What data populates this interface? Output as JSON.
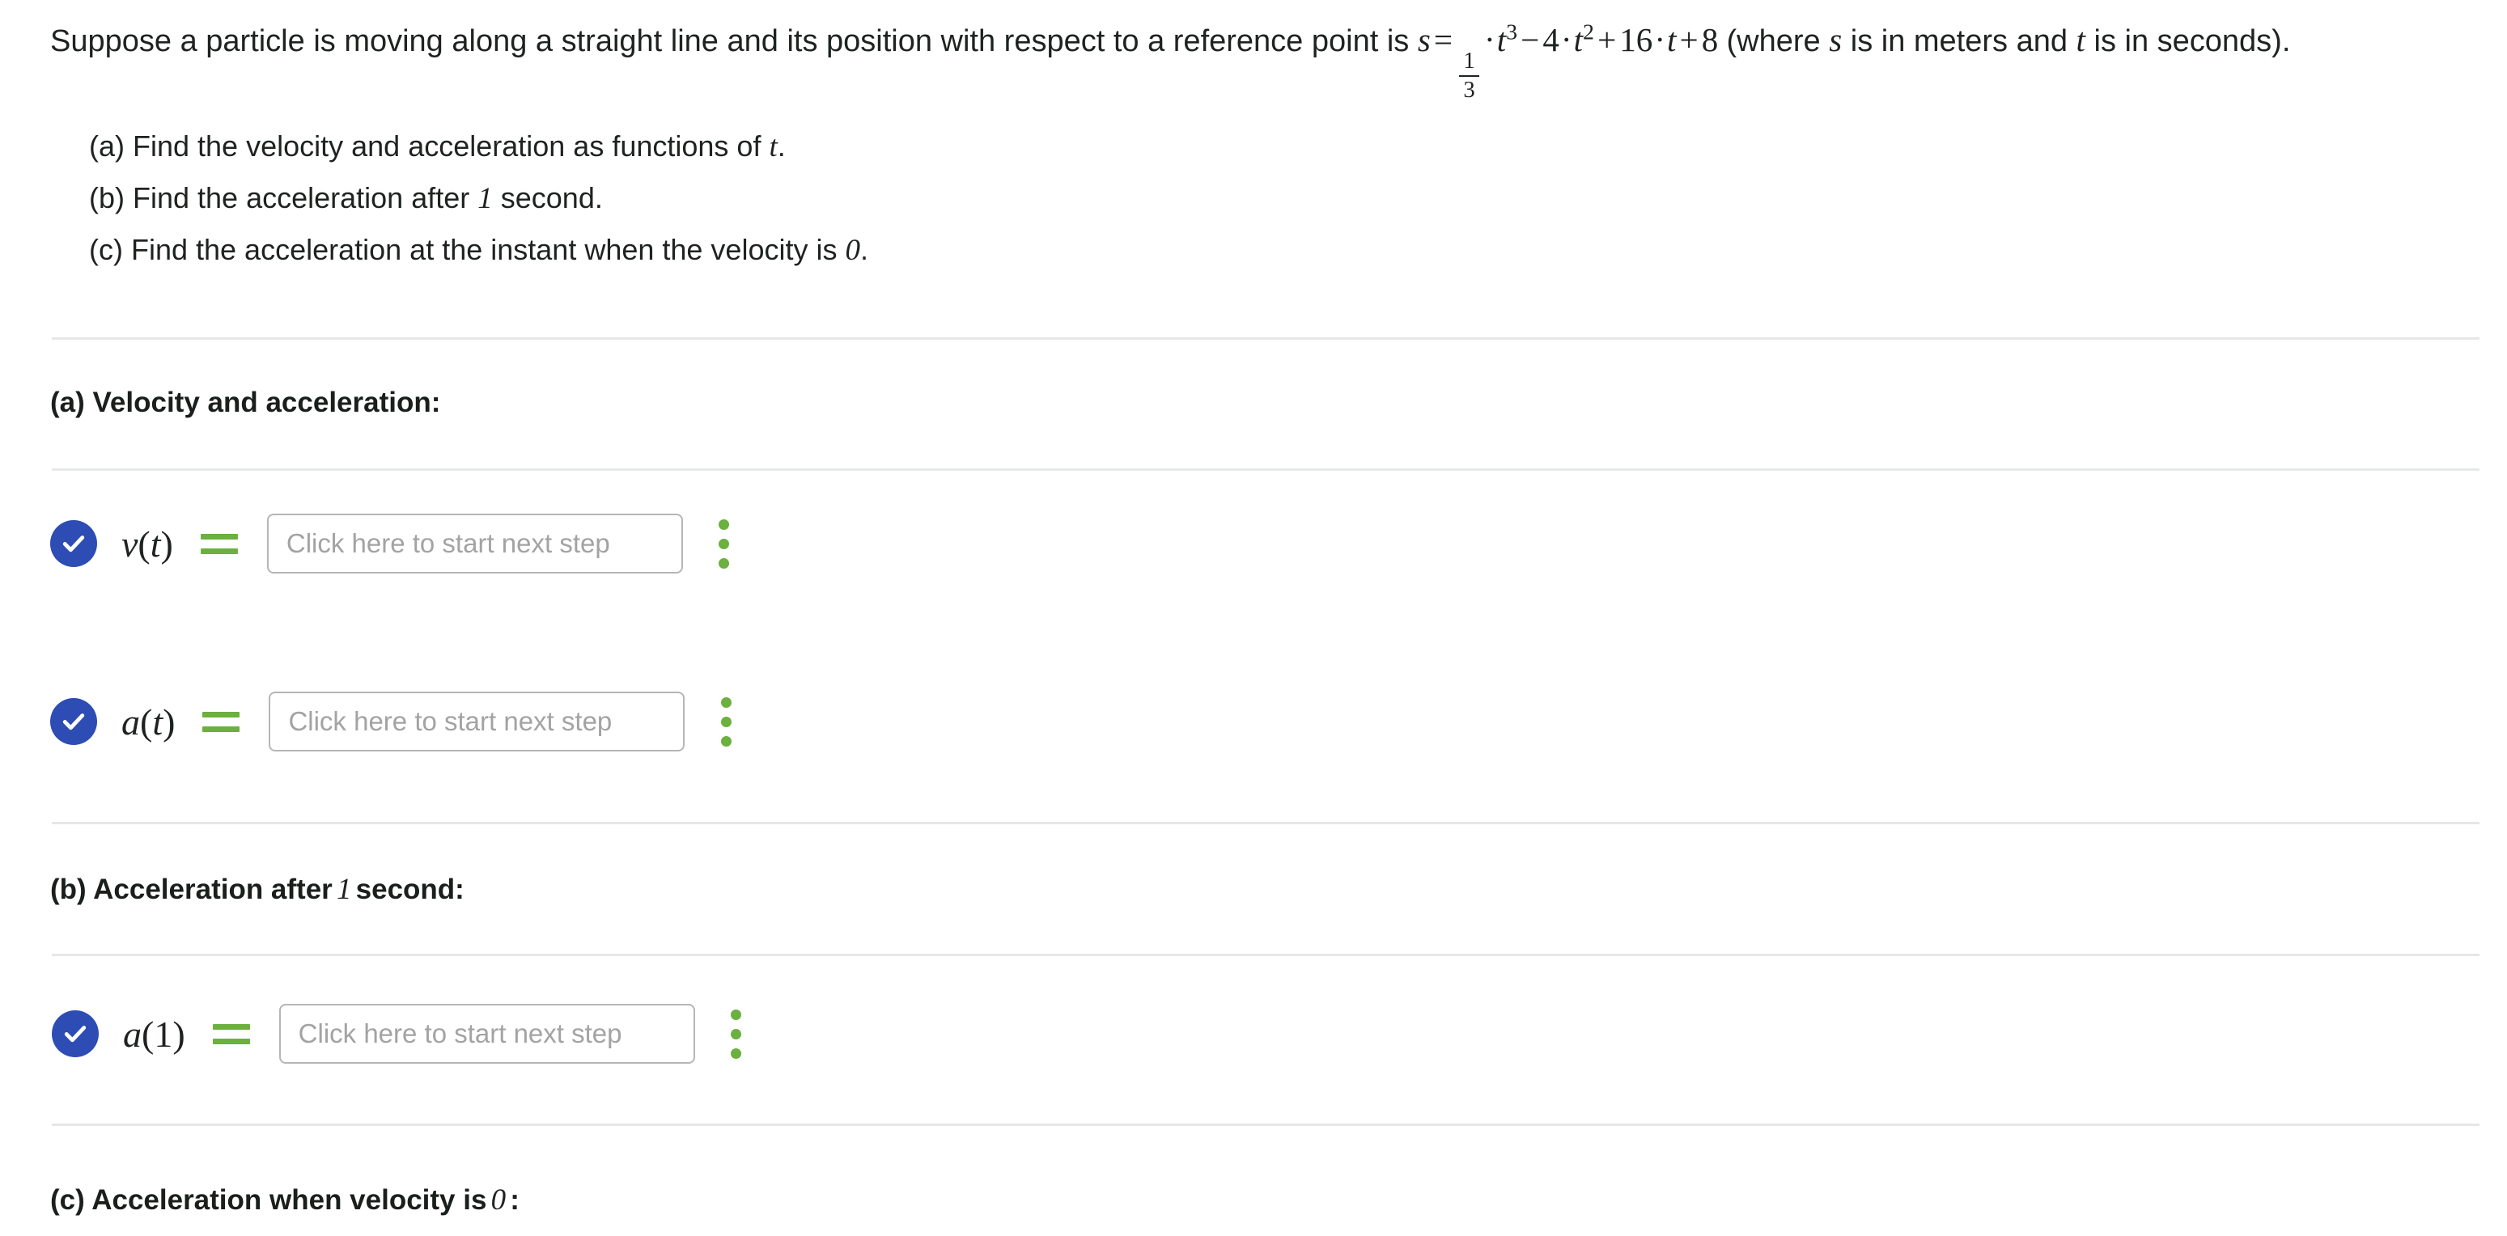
{
  "problem": {
    "intro_before_formula": "Suppose a particle is moving along a straight line and its position with respect to a reference point is",
    "formula": {
      "lhs": "s",
      "equals": "=",
      "frac_num": "1",
      "frac_den": "3",
      "cdot1": "·",
      "t1": "t",
      "exp1": "3",
      "minus": "−",
      "coef2": "4",
      "cdot2": "·",
      "t2": "t",
      "exp2": "2",
      "plus1": "+",
      "coef3": "16",
      "cdot3": "·",
      "t3": "t",
      "plus2": "+",
      "const": "8"
    },
    "note_open": "(where",
    "note_var1": "s",
    "note_mid": "is in meters and",
    "note_var2": "t",
    "note_close": "is in seconds).",
    "subparts": [
      {
        "prefix": "(a) Find the velocity and acceleration as functions of",
        "math": "t",
        "suffix": "."
      },
      {
        "prefix": "(b) Find the acceleration after",
        "math": "1",
        "suffix": "second."
      },
      {
        "prefix": "(c) Find the acceleration at the instant when the velocity is",
        "math": "0",
        "suffix": "."
      }
    ]
  },
  "sections": [
    {
      "id": "a",
      "heading_prefix": "(a) Velocity and acceleration:",
      "heading_math": "",
      "heading_suffix": "",
      "steps": [
        {
          "label_fn": "v",
          "label_open": "(",
          "label_arg": "t",
          "label_close": ")",
          "equals": "=",
          "placeholder": "Click here to start next step",
          "value": "",
          "status": "complete"
        },
        {
          "label_fn": "a",
          "label_open": "(",
          "label_arg": "t",
          "label_close": ")",
          "equals": "=",
          "placeholder": "Click here to start next step",
          "value": "",
          "status": "complete"
        }
      ]
    },
    {
      "id": "b",
      "heading_prefix": "(b) Acceleration after",
      "heading_math": "1",
      "heading_suffix": "second:",
      "steps": [
        {
          "label_fn": "a",
          "label_open": "(",
          "label_arg": "1",
          "label_close": ")",
          "equals": "=",
          "placeholder": "Click here to start next step",
          "value": "",
          "status": "complete"
        }
      ]
    },
    {
      "id": "c",
      "heading_prefix": "(c) Acceleration when velocity is",
      "heading_math": "0",
      "heading_suffix": ":",
      "steps": []
    }
  ],
  "colors": {
    "check_badge": "#2d4cb4",
    "equals_green": "#6cb03f",
    "kebab_green": "#6cb03f",
    "divider": "#e6e7e8",
    "input_border": "#b6b6b6",
    "placeholder_text": "#a3a3a3",
    "body_text": "#1f2320"
  },
  "icons": {
    "check": "check-circle-icon",
    "menu": "kebab-menu-icon"
  }
}
